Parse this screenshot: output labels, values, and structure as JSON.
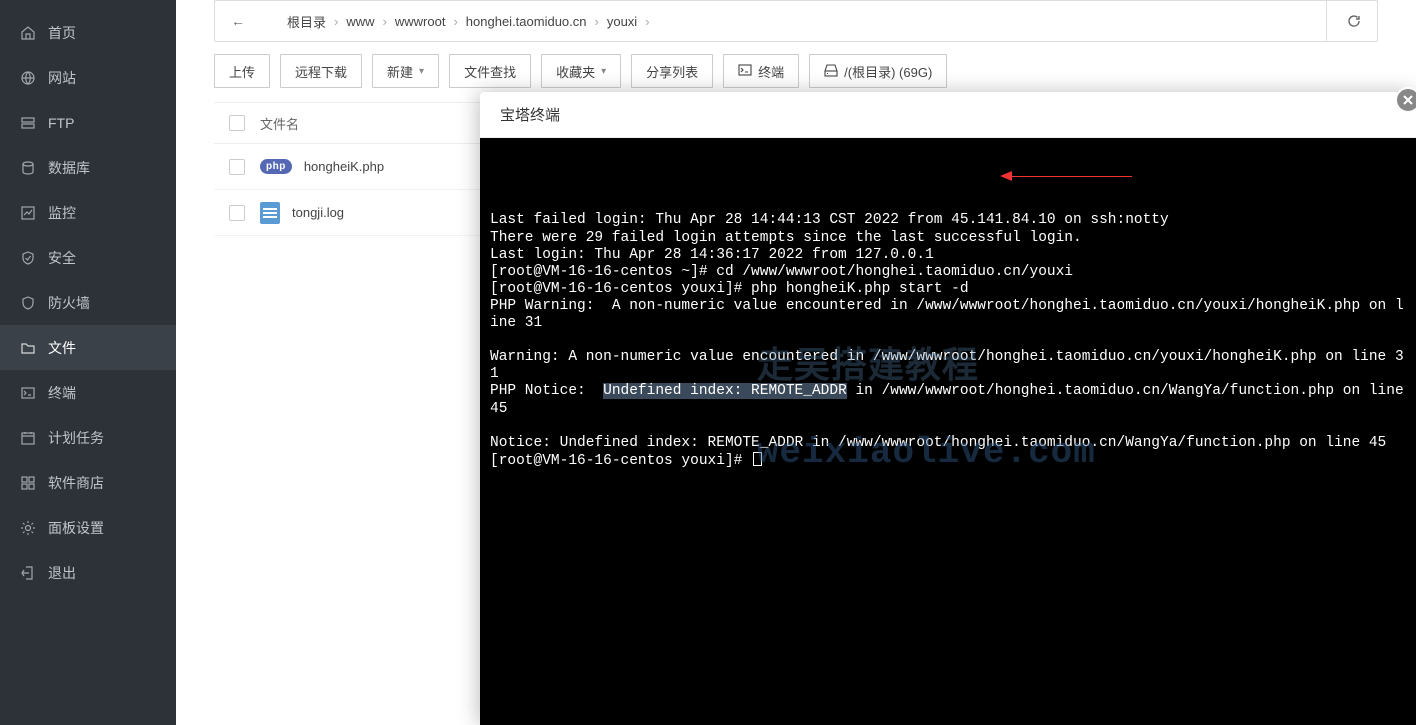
{
  "sidebar": {
    "items": [
      {
        "id": "home",
        "label": "首页"
      },
      {
        "id": "site",
        "label": "网站"
      },
      {
        "id": "ftp",
        "label": "FTP"
      },
      {
        "id": "database",
        "label": "数据库"
      },
      {
        "id": "monitor",
        "label": "监控"
      },
      {
        "id": "security",
        "label": "安全"
      },
      {
        "id": "firewall",
        "label": "防火墙"
      },
      {
        "id": "files",
        "label": "文件"
      },
      {
        "id": "terminal",
        "label": "终端"
      },
      {
        "id": "cron",
        "label": "计划任务"
      },
      {
        "id": "appstore",
        "label": "软件商店"
      },
      {
        "id": "panel",
        "label": "面板设置"
      },
      {
        "id": "logout",
        "label": "退出"
      }
    ],
    "active_id": "files"
  },
  "breadcrumb": {
    "parts": [
      "根目录",
      "www",
      "wwwroot",
      "honghei.taomiduo.cn",
      "youxi"
    ]
  },
  "toolbar": {
    "upload": "上传",
    "remote": "远程下载",
    "new": "新建",
    "search": "文件查找",
    "fav": "收藏夹",
    "share": "分享列表",
    "terminal": "终端",
    "disk": "/(根目录) (69G)"
  },
  "filetable": {
    "head_name": "文件名",
    "rows": [
      {
        "icon": "php",
        "name": "hongheiK.php"
      },
      {
        "icon": "log",
        "name": "tongji.log"
      }
    ]
  },
  "modal": {
    "title": "宝塔终端"
  },
  "terminal": {
    "lines": [
      {
        "t": "Last failed login: Thu Apr 28 14:44:13 CST 2022 from 45.141.84.10 on ssh:notty"
      },
      {
        "t": "There were 29 failed login attempts since the last successful login."
      },
      {
        "t": "Last login: Thu Apr 28 14:36:17 2022 from 127.0.0.1"
      },
      {
        "t": "[root@VM-16-16-centos ~]# cd /www/wwwroot/honghei.taomiduo.cn/youxi"
      },
      {
        "t": "[root@VM-16-16-centos youxi]# php hongheiK.php start -d"
      },
      {
        "t": "PHP Warning:  A non-numeric value encountered in /www/wwwroot/honghei.taomiduo.cn/youxi/hongheiK.php on line 31"
      },
      {
        "t": ""
      },
      {
        "t": "Warning: A non-numeric value encountered in /www/wwwroot/honghei.taomiduo.cn/youxi/hongheiK.php on line 31"
      },
      {
        "pre": "PHP Notice:  ",
        "hi": "Undefined index: REMOTE_ADDR",
        "post": " in /www/wwwroot/honghei.taomiduo.cn/WangYa/function.php on line 45"
      },
      {
        "t": ""
      },
      {
        "t": "Notice: Undefined index: REMOTE_ADDR in /www/wwwroot/honghei.taomiduo.cn/WangYa/function.php on line 45"
      },
      {
        "prompt": "[root@VM-16-16-centos youxi]# "
      }
    ]
  },
  "watermark": {
    "a": "走吴搭建教程",
    "b": "weixiaolive.com"
  }
}
